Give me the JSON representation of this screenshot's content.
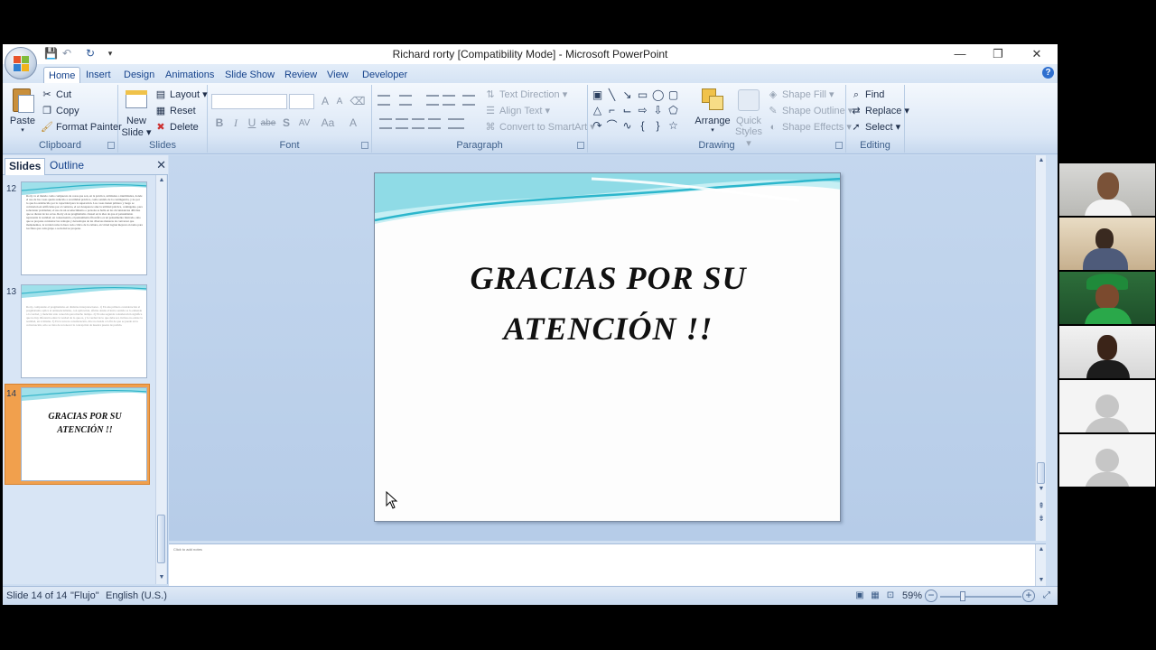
{
  "window": {
    "title": "Richard rorty [Compatibility Mode] - Microsoft PowerPoint",
    "controls": {
      "minimize": "—",
      "restore": "❐",
      "close": "✕"
    }
  },
  "quick_access": {
    "save": "💾",
    "undo": "↶",
    "redo": "↻",
    "customize": "▾"
  },
  "tabs": [
    "Home",
    "Insert",
    "Design",
    "Animations",
    "Slide Show",
    "Review",
    "View",
    "Developer"
  ],
  "active_tab": "Home",
  "ribbon": {
    "clipboard": {
      "label": "Clipboard",
      "paste": "Paste",
      "cut": "Cut",
      "copy": "Copy",
      "format_painter": "Format Painter"
    },
    "slides": {
      "label": "Slides",
      "new_slide_line1": "New",
      "new_slide_line2": "Slide ▾",
      "layout": "Layout ▾",
      "reset": "Reset",
      "delete": "Delete"
    },
    "font": {
      "label": "Font",
      "bold": "B",
      "italic": "I",
      "underline": "U",
      "strike": "abe",
      "shadow": "S",
      "spacing": "AV",
      "case": "Aa",
      "color": "A",
      "grow": "A",
      "shrink": "A"
    },
    "paragraph": {
      "label": "Paragraph",
      "text_direction": "Text Direction ▾",
      "align_text": "Align Text ▾",
      "convert_smartart": "Convert to SmartArt ▾"
    },
    "drawing": {
      "label": "Drawing",
      "arrange": "Arrange",
      "quick_styles_line1": "Quick",
      "quick_styles_line2": "Styles ▾",
      "shape_fill": "Shape Fill ▾",
      "shape_outline": "Shape Outline ▾",
      "shape_effects": "Shape Effects ▾"
    },
    "editing": {
      "label": "Editing",
      "find": "Find",
      "replace": "Replace ▾",
      "select": "Select ▾"
    }
  },
  "left_pane": {
    "tab_slides": "Slides",
    "tab_outline": "Outline",
    "close": "✕",
    "thumbnails": [
      {
        "number": "12",
        "text": "Rorty ve el mundo como compuesto de cosas que son, en la práctica, utilidades o inutilidades, donde el uso de las cosas queda reducido a su utilidad práctica, como sentido de la contingencia, y no por lo que da establecido por la capacidad para la superación. Las cosas tienen primero y luego se convierten en artificiales por el contexto, el ser desaparece ante la utilidad práctica, contingente, para solucionar problemas; el uso de un acontecimiento o persona se halla en las circunstancias difíciles que se dieron de los actos. Rorty en su pragmatismo clausal en la idea de que el pensamiento representa la realidad; en consecuencia, el pensamiento filosófico es un pensamiento ilustrado, sino que se propone contrastar las ventajas y desventajas de las diversas maneras de conversar que mantenemos, la verdad como la hace todo crítico de la cultura, en virtud logran mejorar en tanto para los fines que cada grupo o sociedad se propone."
      },
      {
        "number": "13",
        "text": "Rorty, comprende el pragmatismo en distintas interpretaciones. 1) En una primera consideración el pragmatismo aplica al antiesencialismo, con aplicación, afirma donde el único sentido se lo entiende a la verdad, y mención sólo conocida para mucho tiempo. 2) En una segunda consideración significa que no hay diferencia entre la verdad de lo que es, y la verdad de lo que debe ser, incluso no existe la realidad, en sí misma. 3) En la tercera consideración, dice no tiende a la fin de que se puede en la conversación, sólo se trata de reconocer la concepción de nuestra puesta de partida."
      },
      {
        "number": "14",
        "title": "GRACIAS  POR  SU ATENCIÓN !!"
      }
    ]
  },
  "slide": {
    "title_line1": "GRACIAS  POR  SU",
    "title_line2": "ATENCIÓN !!"
  },
  "notes": {
    "placeholder": "Click to add notes"
  },
  "status": {
    "slide_counter": "Slide 14 of 14",
    "theme": "\"Flujo\"",
    "language": "English (U.S.)",
    "zoom": "59%"
  },
  "colors": {
    "ribbon_text": "#15428b",
    "selected_thumb": "#f1a04d",
    "wave_teal": "#3fbfd0"
  }
}
